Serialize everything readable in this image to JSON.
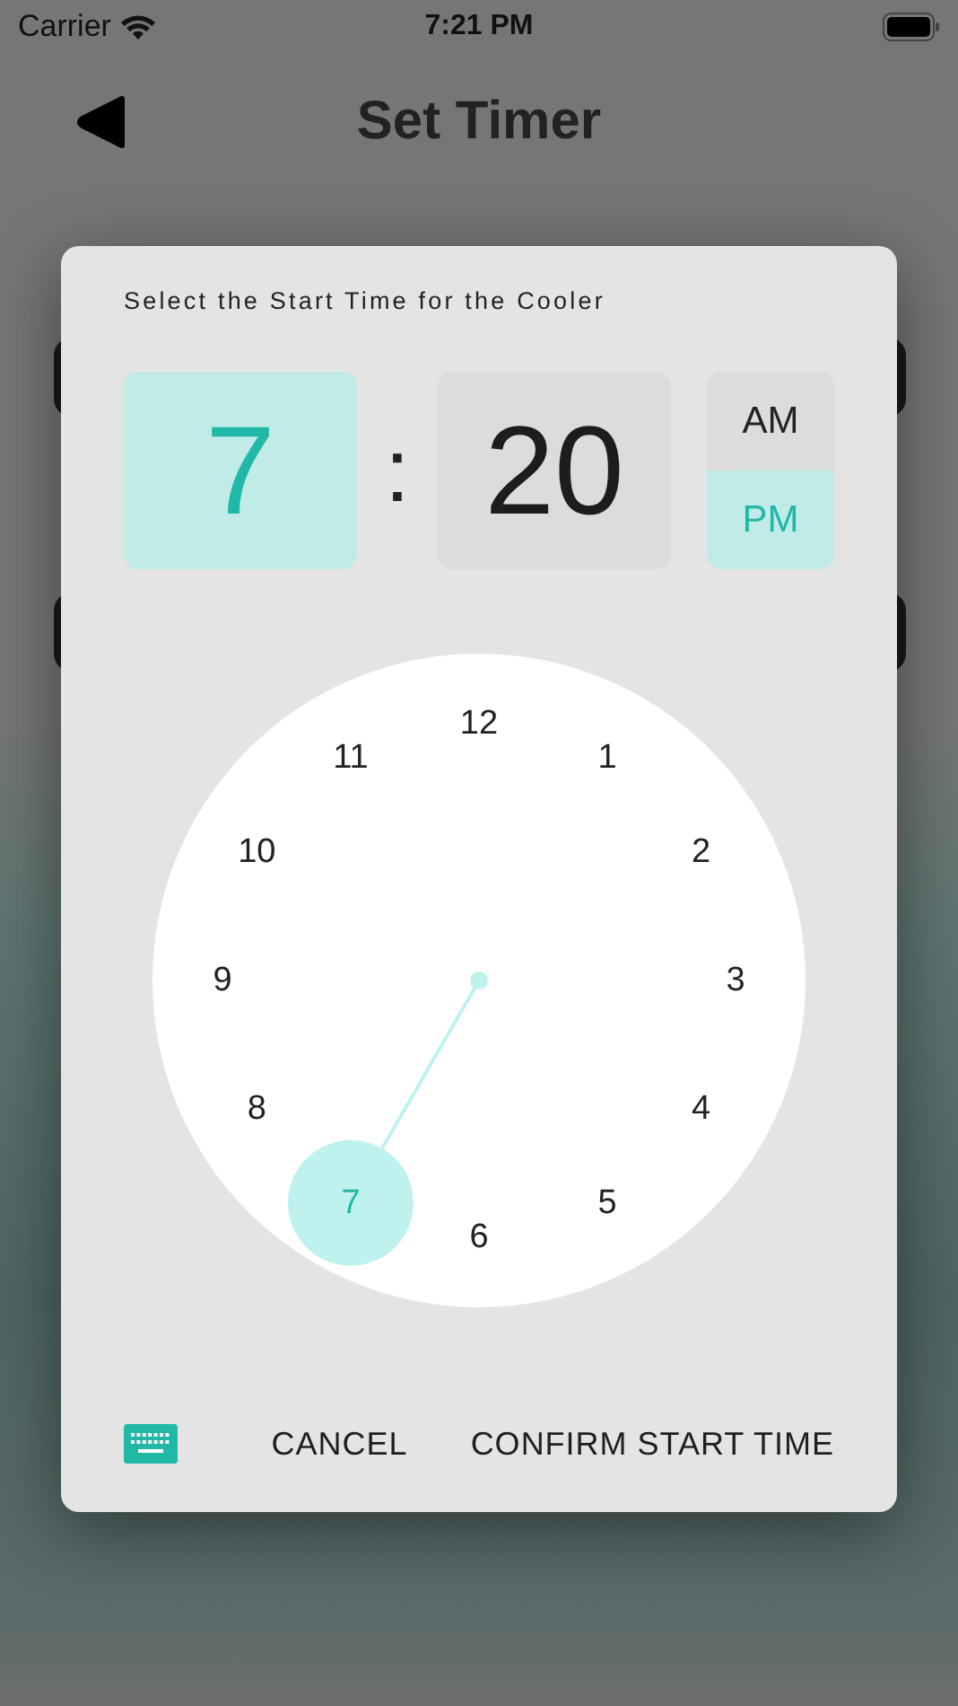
{
  "status_bar": {
    "carrier": "Carrier",
    "time": "7:21 PM"
  },
  "nav": {
    "title": "Set Timer"
  },
  "dialog": {
    "title": "Select the Start Time for the Cooler",
    "hour": {
      "value": "7",
      "selected": true
    },
    "separator": ":",
    "minute": {
      "value": "20",
      "selected": false
    },
    "meridiem": [
      {
        "label": "AM",
        "selected": false
      },
      {
        "label": "PM",
        "selected": true
      }
    ],
    "clock": {
      "numbers": [
        {
          "label": "12",
          "selected": false
        },
        {
          "label": "1",
          "selected": false
        },
        {
          "label": "2",
          "selected": false
        },
        {
          "label": "3",
          "selected": false
        },
        {
          "label": "4",
          "selected": false
        },
        {
          "label": "5",
          "selected": false
        },
        {
          "label": "6",
          "selected": false
        },
        {
          "label": "7",
          "selected": true
        },
        {
          "label": "8",
          "selected": false
        },
        {
          "label": "9",
          "selected": false
        },
        {
          "label": "10",
          "selected": false
        },
        {
          "label": "11",
          "selected": false
        }
      ]
    },
    "buttons": [
      {
        "label": "CANCEL"
      },
      {
        "label": "CONFIRM START TIME"
      }
    ]
  }
}
